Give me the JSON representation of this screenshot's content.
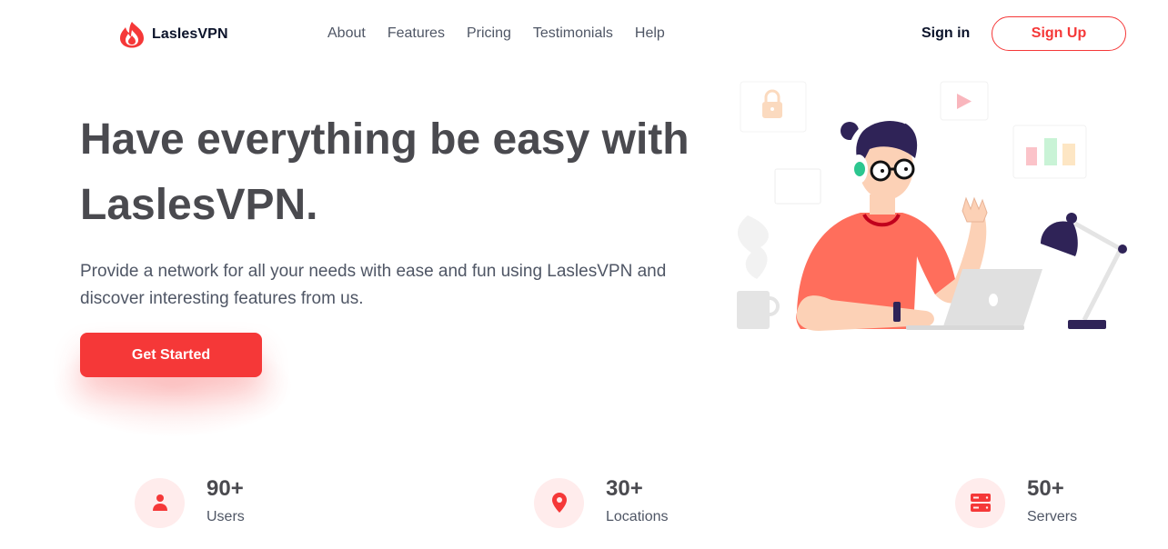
{
  "brand": {
    "name": "LaslesVPN",
    "accent": "#f53838"
  },
  "nav": {
    "items": [
      "About",
      "Features",
      "Pricing",
      "Testimonials",
      "Help"
    ]
  },
  "auth": {
    "signin_label": "Sign in",
    "signup_label": "Sign Up"
  },
  "hero": {
    "title": "Have everything be easy with LaslesVPN.",
    "subtitle": "Provide a network for all your needs with ease and fun using LaslesVPN and discover interesting features from us.",
    "cta_label": "Get Started"
  },
  "stats": [
    {
      "value": "90+",
      "label": "Users",
      "icon": "user-icon"
    },
    {
      "value": "30+",
      "label": "Locations",
      "icon": "location-pin-icon"
    },
    {
      "value": "50+",
      "label": "Servers",
      "icon": "server-icon"
    }
  ]
}
